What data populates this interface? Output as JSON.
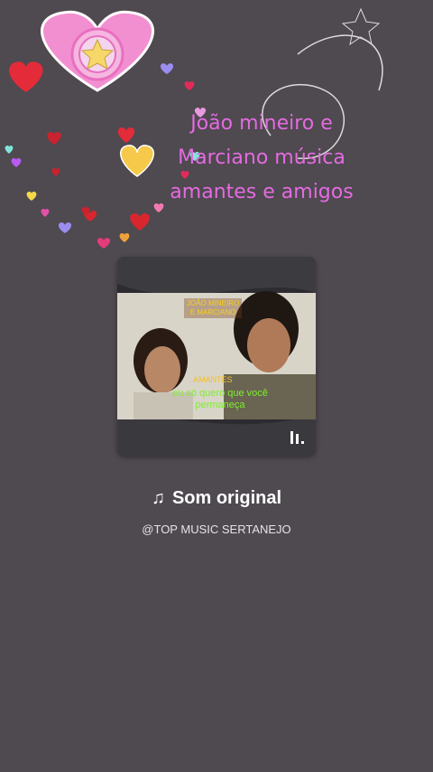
{
  "overlay": {
    "lines": [
      "João mineiro e",
      "Marciano música",
      "amantes e amigos"
    ]
  },
  "cover": {
    "album_title_lines": [
      "JOÃO MINEIRO",
      "E MARCIANO"
    ],
    "song_tag": "AMANTES",
    "lyric_lines": [
      "eu só quero que você",
      "permaneça"
    ]
  },
  "sound": {
    "note_icon": "♫",
    "title": "Som original",
    "author": "@TOP MUSIC SERTANEJO"
  },
  "colors": {
    "background": "#4f4950",
    "overlay_text": "#e46be0",
    "lyric_text": "#7cf02c"
  }
}
